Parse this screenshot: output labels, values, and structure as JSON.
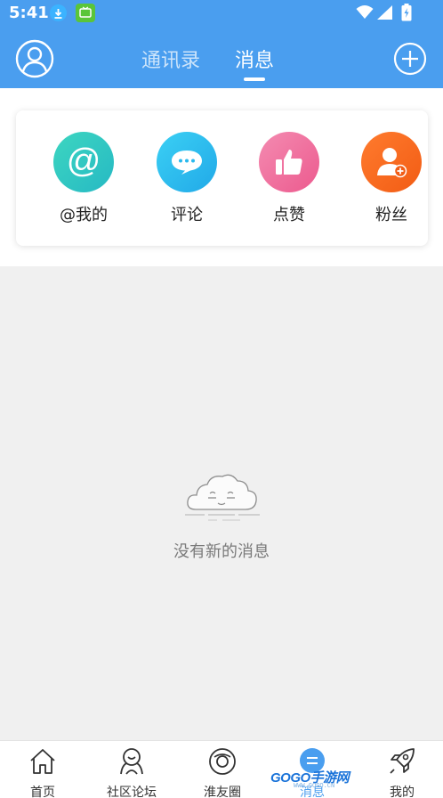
{
  "status_bar": {
    "time": "5:41"
  },
  "header": {
    "tabs": [
      {
        "label": "通讯录",
        "active": false
      },
      {
        "label": "消息",
        "active": true
      }
    ]
  },
  "message_types": [
    {
      "label": "@我的",
      "icon": "at-icon",
      "color": "#2ec9be"
    },
    {
      "label": "评论",
      "icon": "comment-icon",
      "color": "#29b9ee"
    },
    {
      "label": "点赞",
      "icon": "thumbs-up-icon",
      "color": "#f06b9b"
    },
    {
      "label": "粉丝",
      "icon": "add-user-icon",
      "color": "#fa6a20"
    }
  ],
  "empty_state": {
    "text": "没有新的消息",
    "icon": "sleepy-cloud-icon"
  },
  "bottom_nav": [
    {
      "label": "首页",
      "icon": "home-icon",
      "active": false
    },
    {
      "label": "社区论坛",
      "icon": "community-icon",
      "active": false
    },
    {
      "label": "淮友圈",
      "icon": "friend-circle-icon",
      "active": false
    },
    {
      "label": "消息",
      "icon": "message-icon",
      "active": true
    },
    {
      "label": "我的",
      "icon": "rocket-icon",
      "active": false
    }
  ],
  "watermark": {
    "brand": "GOGO手游网",
    "url": "WWW.GOGO.CN"
  },
  "colors": {
    "primary": "#4a9eef",
    "background": "#f0f0f0"
  }
}
